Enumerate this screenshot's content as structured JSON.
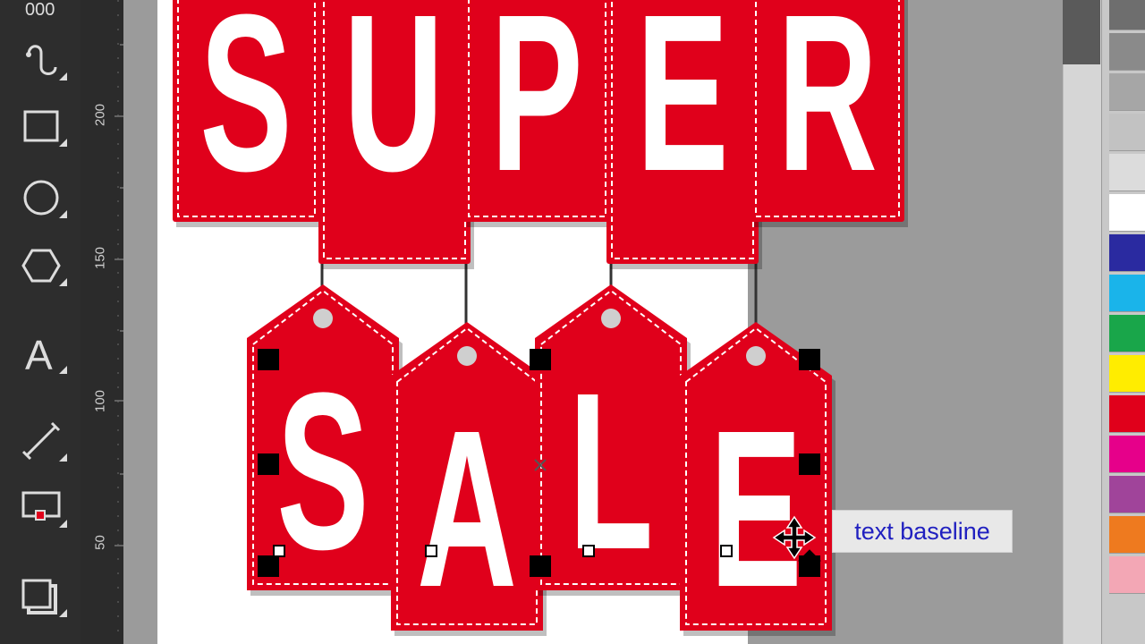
{
  "toolbox": {
    "tools": [
      {
        "name": "zoom-tool"
      },
      {
        "name": "freehand-tool"
      },
      {
        "name": "rectangle-tool"
      },
      {
        "name": "ellipse-tool"
      },
      {
        "name": "polygon-tool"
      },
      {
        "name": "text-tool",
        "glyph": "A"
      },
      {
        "name": "connector-tool"
      },
      {
        "name": "interactive-fill-tool"
      },
      {
        "name": "drop-shadow-tool"
      }
    ]
  },
  "ruler": {
    "labels": [
      "200",
      "150",
      "100",
      "50"
    ]
  },
  "artwork": {
    "top_word": [
      "S",
      "U",
      "P",
      "E",
      "R"
    ],
    "bottom_word": [
      "S",
      "A",
      "L",
      "E"
    ],
    "tag_color": "#e0001b",
    "stitch_color": "#ffffff"
  },
  "tooltip": {
    "text": "text baseline"
  },
  "palette": {
    "colors": [
      "#6e6e6e",
      "#8a8a8a",
      "#a6a6a6",
      "#c2c2c2",
      "#dcdcdc",
      "#ffffff",
      "#2a2aa0",
      "#1ab4ea",
      "#19a64a",
      "#ffed00",
      "#e0001b",
      "#e6008a",
      "#a0449a",
      "#ee7a1f",
      "#f3a7b5"
    ]
  }
}
